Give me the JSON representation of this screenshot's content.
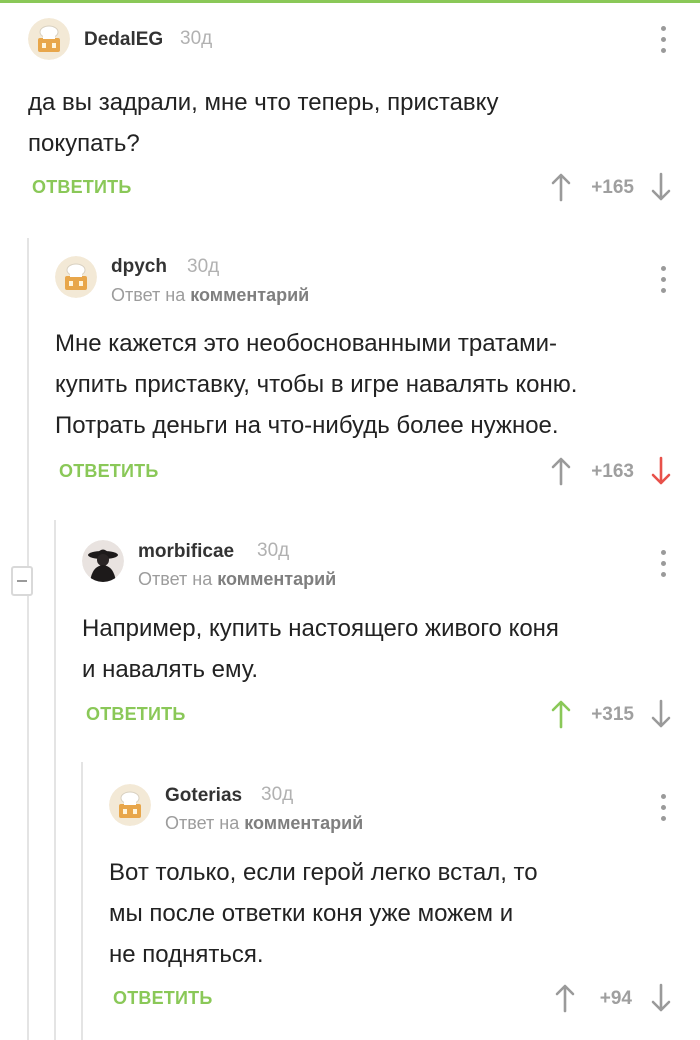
{
  "colors": {
    "accent_green": "#8ac858",
    "vote_neutral": "#9a9a9a",
    "vote_down_active": "#e8514a",
    "vote_up_active": "#8ac858"
  },
  "comments": [
    {
      "username": "DedalEG",
      "time": "30д",
      "text_lines": [
        "да вы задрали, мне что теперь, приставку",
        "покупать?"
      ],
      "reply_label": "ОТВЕТИТЬ",
      "score": "+165",
      "vote_state": "none",
      "avatar_icon": "chef-avatar-icon"
    },
    {
      "username": "dpych",
      "time": "30д",
      "reply_to_prefix": "Ответ на",
      "reply_to_target": "комментарий",
      "text_lines": [
        "Мне кажется это необоснованными тратами-",
        "купить приставку, чтобы в игре навалять коню.",
        "Потрать деньги на что-нибудь более нужное."
      ],
      "reply_label": "ОТВЕТИТЬ",
      "score": "+163",
      "vote_state": "down",
      "avatar_icon": "chef-avatar-icon"
    },
    {
      "username": "morbificae",
      "time": "30д",
      "reply_to_prefix": "Ответ на",
      "reply_to_target": "комментарий",
      "text_lines": [
        "Например, купить настоящего живого коня",
        "и навалять ему."
      ],
      "reply_label": "ОТВЕТИТЬ",
      "score": "+315",
      "vote_state": "up",
      "avatar_icon": "hooded-figure-avatar-icon"
    },
    {
      "username": "Goterias",
      "time": "30д",
      "reply_to_prefix": "Ответ на",
      "reply_to_target": "комментарий",
      "text_lines": [
        "Вот только, если герой легко встал, то",
        "мы после ответки коня уже можем и",
        "не подняться."
      ],
      "reply_label": "ОТВЕТИТЬ",
      "score": "+94",
      "vote_state": "none",
      "avatar_icon": "chef-avatar-icon"
    }
  ]
}
